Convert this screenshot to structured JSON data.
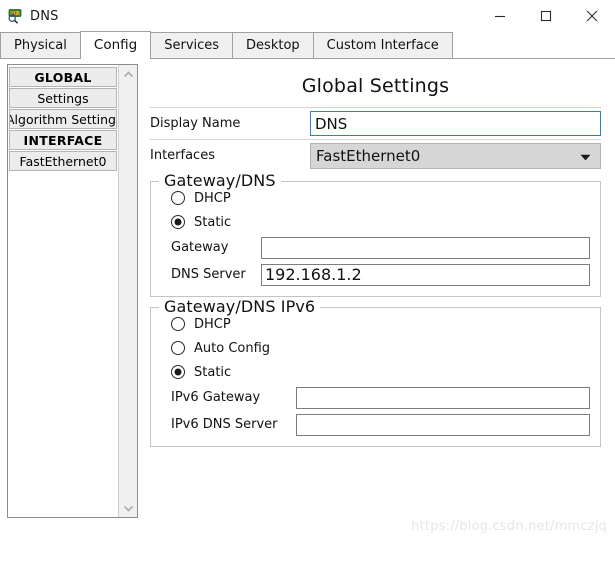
{
  "window": {
    "title": "DNS",
    "icon": "dns-server-magnifier-icon",
    "minimize_label": "—",
    "maximize_label": "□",
    "close_label": "✕"
  },
  "tabs": [
    {
      "label": "Physical",
      "active": false
    },
    {
      "label": "Config",
      "active": true
    },
    {
      "label": "Services",
      "active": false
    },
    {
      "label": "Desktop",
      "active": false
    },
    {
      "label": "Custom Interface",
      "active": false
    }
  ],
  "sidebar": {
    "items": [
      {
        "label": "GLOBAL",
        "type": "header"
      },
      {
        "label": "Settings",
        "type": "item"
      },
      {
        "label": "Algorithm Settings",
        "type": "item"
      },
      {
        "label": "INTERFACE",
        "type": "header"
      },
      {
        "label": "FastEthernet0",
        "type": "item"
      }
    ],
    "scroll_up": "⌃",
    "scroll_down": "⌄"
  },
  "main": {
    "title": "Global Settings",
    "display_name": {
      "label": "Display Name",
      "value": "DNS",
      "placeholder": ""
    },
    "interfaces": {
      "label": "Interfaces",
      "value": "FastEthernet0",
      "caret": "▼",
      "options": [
        "FastEthernet0"
      ]
    },
    "gateway_dns": {
      "title": "Gateway/DNS",
      "options": [
        {
          "label": "DHCP",
          "selected": false
        },
        {
          "label": "Static",
          "selected": true
        }
      ],
      "gateway": {
        "label": "Gateway",
        "value": "",
        "placeholder": ""
      },
      "dns_server": {
        "label": "DNS Server",
        "value": "192.168.1.2",
        "placeholder": ""
      }
    },
    "gateway_dns_ipv6": {
      "title": "Gateway/DNS IPv6",
      "options": [
        {
          "label": "DHCP",
          "selected": false
        },
        {
          "label": "Auto Config",
          "selected": false
        },
        {
          "label": "Static",
          "selected": true
        }
      ],
      "gateway": {
        "label": "IPv6 Gateway",
        "value": "",
        "placeholder": ""
      },
      "dns_server": {
        "label": "IPv6 DNS Server",
        "value": "",
        "placeholder": ""
      }
    }
  },
  "watermark": {
    "text": "https://blog.csdn.net/mmczjq"
  },
  "colors": {
    "focus_border": "#2a7fd4",
    "tab_inactive_bg": "#f0f0f0",
    "sidebar_item_bg": "#ececec",
    "combo_bg": "#d6d6d6",
    "watermark": "#e6e6e6"
  }
}
